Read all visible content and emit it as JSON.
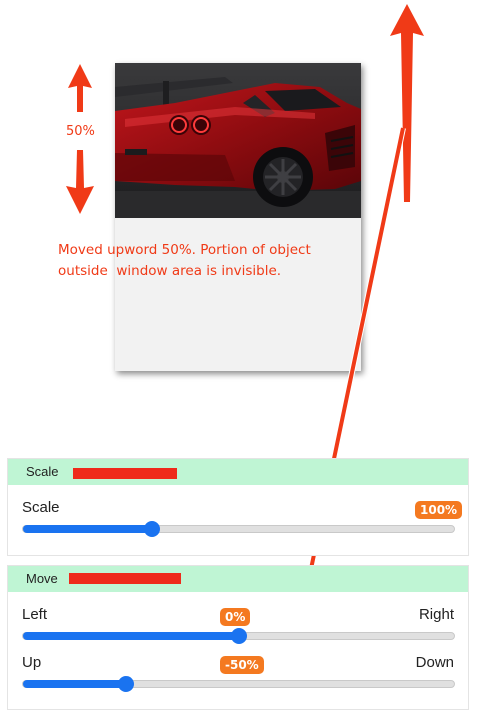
{
  "annotation": {
    "percent_label": "50%",
    "caption_line1": "Moved upword 50%. Portion of object",
    "caption_line2": "outside  window area is invisible.",
    "color": "#f03a17"
  },
  "preview": {
    "image": "red-sports-car-rear-view"
  },
  "scale_panel": {
    "title": "Scale",
    "label": "Scale",
    "badge": "100%",
    "value_fraction": 0.3
  },
  "move_panel": {
    "title": "Move",
    "horizontal": {
      "left_label": "Left",
      "right_label": "Right",
      "badge": "0%",
      "value_fraction": 0.5
    },
    "vertical": {
      "up_label": "Up",
      "down_label": "Down",
      "badge": "-50%",
      "value_fraction": 0.24
    }
  },
  "colors": {
    "accent_blue": "#1a73f0",
    "badge_orange": "#f47920",
    "header_green": "#bff5d4",
    "redaction_red": "#ef2a1b"
  }
}
